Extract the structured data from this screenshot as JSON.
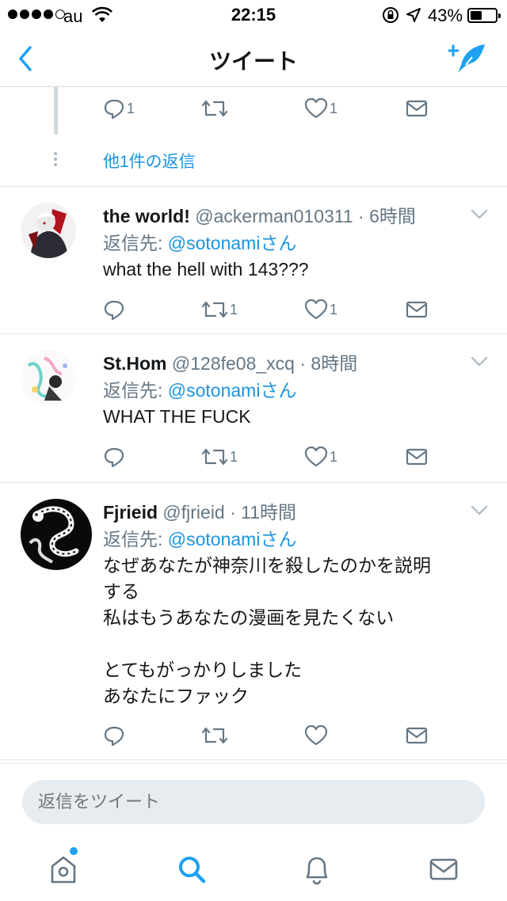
{
  "status_bar": {
    "carrier": "au",
    "time": "22:15",
    "battery": "43%",
    "battery_level": 0.43,
    "icons": [
      "signal-dots-icon",
      "wifi-icon",
      "rotation-lock-icon",
      "location-arrow-icon",
      "battery-icon"
    ]
  },
  "nav": {
    "title": "ツイート",
    "back_icon": "chevron-left-icon",
    "compose_icon": "compose-tweet-icon"
  },
  "colors": {
    "accent": "#1da1f2",
    "link": "#1b95e0",
    "text": "#14171a",
    "muted": "#657786",
    "divider": "#e1e8ed"
  },
  "thread_top": {
    "more_replies": "他1件の返信",
    "actions": {
      "reply_count": "1",
      "retweet_count": "",
      "like_count": "1"
    }
  },
  "tweets": [
    {
      "name": "the world!",
      "handle": "@ackerman010311",
      "time": "· 6時間",
      "reply_label": "返信先: ",
      "reply_to": "@sotonamiさん",
      "text": "what the hell with 143???",
      "reply_count": "",
      "retweet_count": "1",
      "like_count": "1"
    },
    {
      "name": "St.Hom",
      "handle": "@128fe08_xcq",
      "time": "· 8時間",
      "reply_label": "返信先: ",
      "reply_to": "@sotonamiさん",
      "text": "WHAT THE FUCK",
      "reply_count": "",
      "retweet_count": "1",
      "like_count": "1"
    },
    {
      "name": "Fjrieid",
      "handle": "@fjrieid",
      "time": "· 11時間",
      "reply_label": "返信先: ",
      "reply_to": "@sotonamiさん",
      "text": "なぜあなたが神奈川を殺したのかを説明する\n私はもうあなたの漫画を見たくない\n\nとてもがっかりしました\nあなたにファック",
      "reply_count": "",
      "retweet_count": "",
      "like_count": ""
    }
  ],
  "reply_bar": {
    "placeholder": "返信をツイート"
  },
  "tab_bar": {
    "tabs": [
      "home-icon",
      "search-icon",
      "notifications-bell-icon",
      "messages-envelope-icon"
    ],
    "active": "search-icon",
    "home_has_new": true
  }
}
